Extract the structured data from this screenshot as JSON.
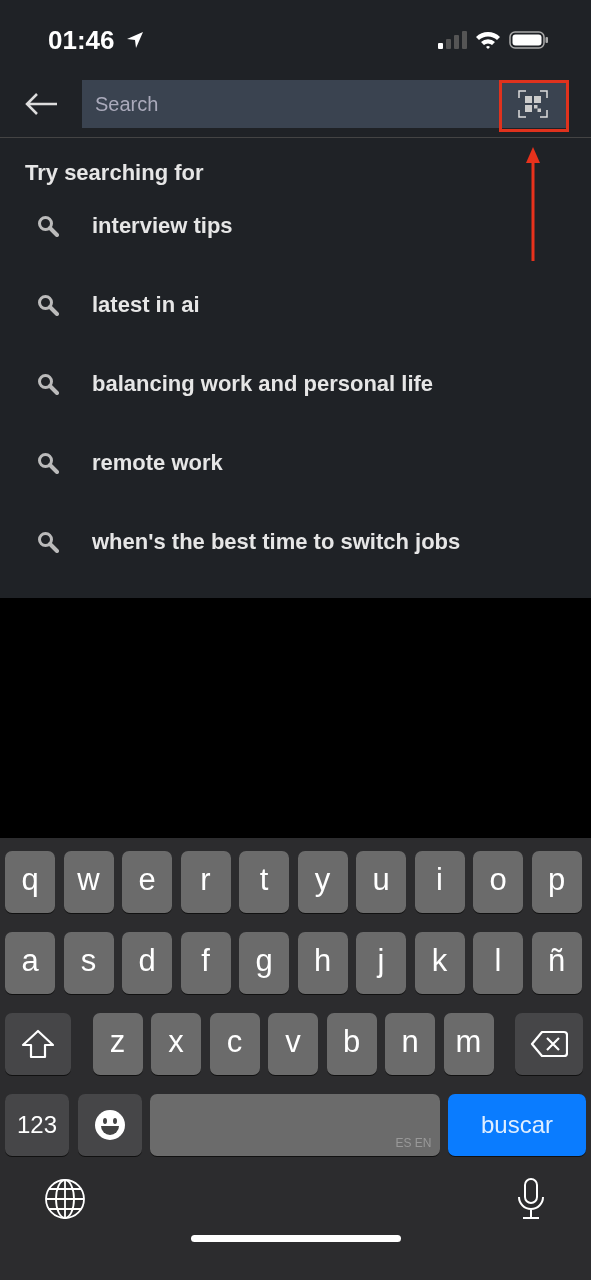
{
  "status_bar": {
    "time": "01:46"
  },
  "search": {
    "placeholder": "Search"
  },
  "suggestions": {
    "title": "Try searching for",
    "items": [
      "interview tips",
      "latest in ai",
      "balancing work and personal life",
      "remote work",
      "when's the best time to switch jobs"
    ]
  },
  "keyboard": {
    "rows": [
      {
        "keys": [
          {
            "kind": "letter",
            "label": "q"
          },
          {
            "kind": "letter",
            "label": "w"
          },
          {
            "kind": "letter",
            "label": "e"
          },
          {
            "kind": "letter",
            "label": "r"
          },
          {
            "kind": "letter",
            "label": "t"
          },
          {
            "kind": "letter",
            "label": "y"
          },
          {
            "kind": "letter",
            "label": "u"
          },
          {
            "kind": "letter",
            "label": "i"
          },
          {
            "kind": "letter",
            "label": "o"
          },
          {
            "kind": "letter",
            "label": "p"
          }
        ]
      },
      {
        "keys": [
          {
            "kind": "letter",
            "label": "a"
          },
          {
            "kind": "letter",
            "label": "s"
          },
          {
            "kind": "letter",
            "label": "d"
          },
          {
            "kind": "letter",
            "label": "f"
          },
          {
            "kind": "letter",
            "label": "g"
          },
          {
            "kind": "letter",
            "label": "h"
          },
          {
            "kind": "letter",
            "label": "j"
          },
          {
            "kind": "letter",
            "label": "k"
          },
          {
            "kind": "letter",
            "label": "l"
          },
          {
            "kind": "letter",
            "label": "ñ"
          }
        ]
      },
      {
        "keys": [
          {
            "kind": "shift"
          },
          {
            "kind": "letter",
            "label": "z"
          },
          {
            "kind": "letter",
            "label": "x"
          },
          {
            "kind": "letter",
            "label": "c"
          },
          {
            "kind": "letter",
            "label": "v"
          },
          {
            "kind": "letter",
            "label": "b"
          },
          {
            "kind": "letter",
            "label": "n"
          },
          {
            "kind": "letter",
            "label": "m"
          },
          {
            "kind": "delete"
          }
        ]
      },
      {
        "keys": [
          {
            "kind": "numbers",
            "label": "123"
          },
          {
            "kind": "emoji"
          },
          {
            "kind": "space",
            "label": "ES EN"
          },
          {
            "kind": "return",
            "label": "buscar"
          }
        ]
      }
    ]
  }
}
